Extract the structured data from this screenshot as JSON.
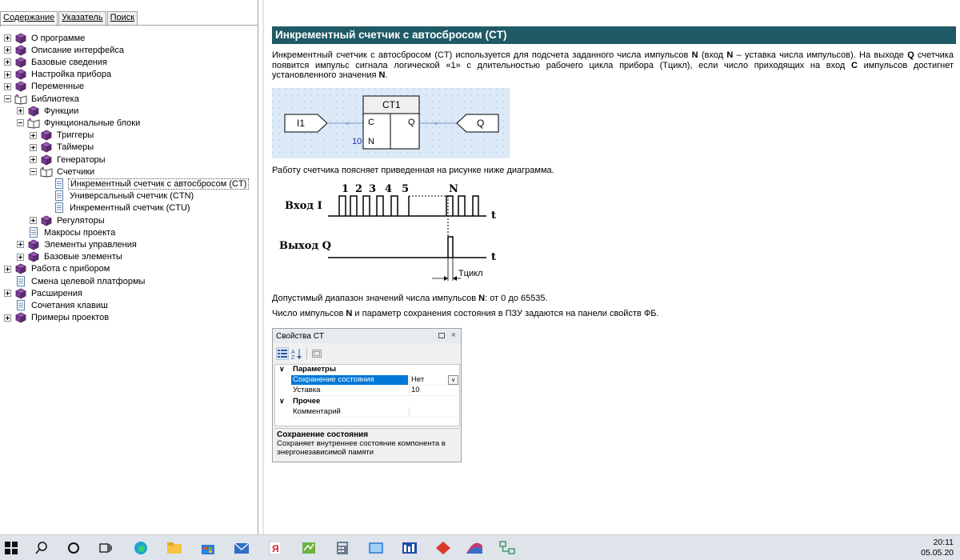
{
  "nav": {
    "tabs": [
      {
        "label": "Содержание",
        "active": true
      },
      {
        "label": "Указатель",
        "active": false
      },
      {
        "label": "Поиск",
        "active": false
      }
    ],
    "tree": [
      {
        "label": "О программе",
        "level": 0,
        "icon": "book",
        "state": "plus"
      },
      {
        "label": "Описание интерфейса",
        "level": 0,
        "icon": "book",
        "state": "plus"
      },
      {
        "label": "Базовые сведения",
        "level": 0,
        "icon": "book",
        "state": "plus"
      },
      {
        "label": "Настройка прибора",
        "level": 0,
        "icon": "book",
        "state": "plus"
      },
      {
        "label": "Переменные",
        "level": 0,
        "icon": "book",
        "state": "plus"
      },
      {
        "label": "Библиотека",
        "level": 0,
        "icon": "open-book",
        "state": "minus"
      },
      {
        "label": "Функции",
        "level": 1,
        "icon": "book",
        "state": "plus"
      },
      {
        "label": "Функциональные блоки",
        "level": 1,
        "icon": "open-book",
        "state": "minus"
      },
      {
        "label": "Триггеры",
        "level": 2,
        "icon": "book",
        "state": "plus"
      },
      {
        "label": "Таймеры",
        "level": 2,
        "icon": "book",
        "state": "plus"
      },
      {
        "label": "Генераторы",
        "level": 2,
        "icon": "book",
        "state": "plus"
      },
      {
        "label": "Счетчики",
        "level": 2,
        "icon": "open-book",
        "state": "minus"
      },
      {
        "label": "Инкрементный счетчик с автосбросом (CT)",
        "level": 3,
        "icon": "page",
        "state": "none",
        "selected": true
      },
      {
        "label": "Универсальный счетчик (CTN)",
        "level": 3,
        "icon": "page",
        "state": "none"
      },
      {
        "label": "Инкрементный счетчик (CTU)",
        "level": 3,
        "icon": "page",
        "state": "none"
      },
      {
        "label": "Регуляторы",
        "level": 2,
        "icon": "book",
        "state": "plus"
      },
      {
        "label": "Макросы проекта",
        "level": 1,
        "icon": "page",
        "state": "none"
      },
      {
        "label": "Элементы управления",
        "level": 1,
        "icon": "book",
        "state": "plus"
      },
      {
        "label": "Базовые элементы",
        "level": 1,
        "icon": "book",
        "state": "plus"
      },
      {
        "label": "Работа с прибором",
        "level": 0,
        "icon": "book",
        "state": "plus"
      },
      {
        "label": "Смена целевой платформы",
        "level": 0,
        "icon": "page",
        "state": "none"
      },
      {
        "label": "Расширения",
        "level": 0,
        "icon": "book",
        "state": "plus"
      },
      {
        "label": "Сочетания клавиш",
        "level": 0,
        "icon": "page",
        "state": "none"
      },
      {
        "label": "Примеры проектов",
        "level": 0,
        "icon": "book",
        "state": "plus"
      }
    ]
  },
  "content": {
    "title": "Инкрементный счетчик с автосбросом (CT)",
    "p1_parts": [
      "Инкрементный счетчик с автосбросом (CT) используется для подсчета заданного числа импульсов ",
      "N",
      " (вход ",
      "N",
      " – уставка числа импульсов). На выходе ",
      "Q",
      " счетчика появится импульс сигнала логической «1» с длительностью рабочего цикла прибора (Тцикл), если число приходящих на вход ",
      "C",
      " импульсов достигнет установленного значения ",
      "N",
      "."
    ],
    "fb": {
      "block_name": "CT1",
      "input_tag": "I1",
      "output_tag": "Q",
      "pin_c": "C",
      "pin_n": "N",
      "pin_q": "Q",
      "setpoint": "10"
    },
    "p2": "Работу счетчика поясняет приведенная на рисунке ниже диаграмма.",
    "pulse": {
      "input_label": "Вход I",
      "output_label": "Выход Q",
      "pulse_numbers": [
        "1",
        "2",
        "3",
        "4",
        "5"
      ],
      "n_label": "N",
      "t_label": "t",
      "tcycle_label": "Тцикл"
    },
    "p3_parts": [
      "Допустимый диапазон значений числа импульсов ",
      "N",
      ": от 0 до 65535."
    ],
    "p4_parts": [
      "Число импульсов ",
      "N",
      " и параметр сохранения состояния в ПЗУ задаются на панели свойств ФБ."
    ]
  },
  "props": {
    "title": "Свойства CT",
    "close": "×",
    "cat1": "Параметры",
    "rows": [
      {
        "name": "Сохранение состояния",
        "value": "Нет",
        "selected": true
      },
      {
        "name": "Уставка",
        "value": "10",
        "selected": false
      }
    ],
    "cat2": "Прочее",
    "rows2": [
      {
        "name": "Комментарий",
        "value": ""
      }
    ],
    "desc_title": "Сохранение состояния",
    "desc_text": "Сохраняет внутреннее состояние компонента в энергонезависимой памяти"
  },
  "taskbar": {
    "time": "20:11",
    "date": "05.05.20"
  }
}
